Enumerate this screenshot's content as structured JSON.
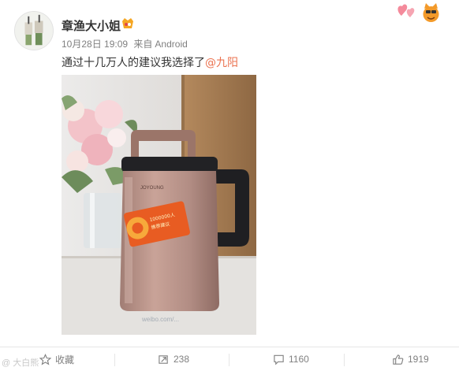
{
  "post": {
    "username": "章渔大小姐",
    "date": "10月28日 19:09",
    "source_label": "来自",
    "source": "Android",
    "text": "通过十几万人的建议我选择了",
    "mention": "@九阳"
  },
  "photo": {
    "brand_text": "JOYOUNG",
    "sticker_line1": "1000000人",
    "sticker_line2": "推荐建议",
    "watermark": "weibo.com/..."
  },
  "actions": {
    "favorite_label": "收藏",
    "repost_count": "238",
    "comment_count": "1160",
    "like_count": "1919"
  },
  "site_watermark": "@ 大白熊"
}
